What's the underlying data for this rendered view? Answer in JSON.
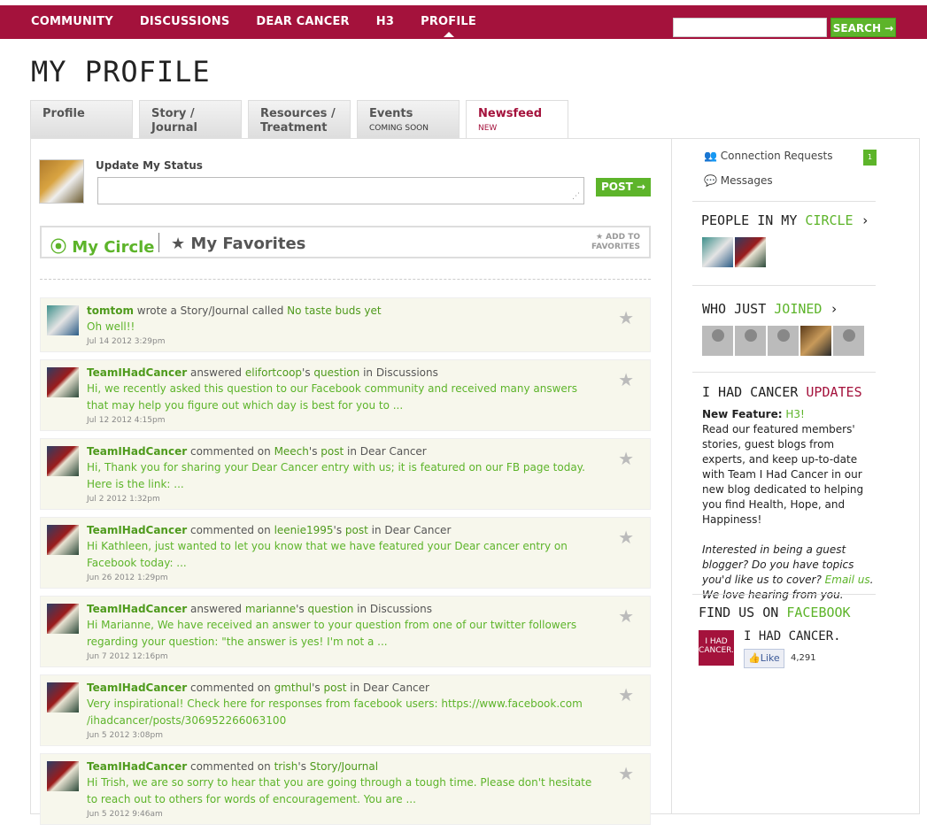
{
  "nav": {
    "items": [
      "COMMUNITY",
      "DISCUSSIONS",
      "DEAR CANCER",
      "H3",
      "PROFILE"
    ],
    "search_label": "SEARCH →"
  },
  "page": {
    "title": "MY PROFILE"
  },
  "tabs": [
    {
      "label": "Profile",
      "sub": ""
    },
    {
      "label": "Story /\nJournal",
      "label1": "Story /",
      "label2": "Journal"
    },
    {
      "label1": "Resources /",
      "label2": "Treatment"
    },
    {
      "label": "Events",
      "sub": "COMING SOON"
    },
    {
      "label": "Newsfeed",
      "sub": "NEW"
    }
  ],
  "status": {
    "label": "Update My Status",
    "post": "POST →"
  },
  "circle": {
    "my_circle": "My Circle",
    "my_favorites": "My Favorites",
    "add1": "★ ADD TO",
    "add2": "FAVORITES"
  },
  "feed": [
    {
      "user": "tomtom",
      "action": " wrote a Story/Journal called ",
      "target": "No taste buds yet",
      "tail": "",
      "body": "Oh well!!",
      "time": "Jul 14 2012 3:29pm"
    },
    {
      "user": "TeamIHadCancer",
      "action": " answered ",
      "target": "elifortcoop",
      "mid": "'s ",
      "target2": "question",
      "tail": " in Discussions",
      "body": "Hi, we recently asked this question to our Facebook community and received many answers that may help you figure out which day is best for you to ...",
      "time": "Jul 12 2012 4:15pm"
    },
    {
      "user": "TeamIHadCancer",
      "action": " commented on ",
      "target": "Meech",
      "mid": "'s ",
      "target2": "post",
      "tail": " in Dear Cancer",
      "body": "Hi, Thank you for sharing your Dear Cancer entry with us; it is featured on our FB page today. Here is the link: ...",
      "time": "Jul 2 2012 1:32pm"
    },
    {
      "user": "TeamIHadCancer",
      "action": " commented on ",
      "target": "leenie1995",
      "mid": "'s ",
      "target2": "post",
      "tail": " in Dear Cancer",
      "body": "Hi Kathleen, just wanted to let you know that we have featured your Dear cancer entry on Facebook today: ...",
      "time": "Jun 26 2012 1:29pm"
    },
    {
      "user": "TeamIHadCancer",
      "action": " answered ",
      "target": "marianne",
      "mid": "'s ",
      "target2": "question",
      "tail": " in Discussions",
      "body": "Hi Marianne, We have received an answer to your question from one of our twitter followers regarding your question: \"the answer is yes! I'm not a ...",
      "time": "Jun 7 2012 12:16pm"
    },
    {
      "user": "TeamIHadCancer",
      "action": " commented on ",
      "target": "gmthul",
      "mid": "'s ",
      "target2": "post",
      "tail": " in Dear Cancer",
      "body": "Very inspirational! Check here for responses from facebook users: https://www.facebook.com /ihadcancer/posts/306952266063100",
      "time": "Jun 5 2012 3:08pm"
    },
    {
      "user": "TeamIHadCancer",
      "action": " commented on ",
      "target": "trish",
      "mid": "'s ",
      "target2": "Story/Journal",
      "tail": "",
      "body": "Hi Trish, we are so sorry to hear that you are going through a tough time. Please don't hesitate to reach out to others for words of encouragement. You are ...",
      "time": "Jun 5 2012 9:46am"
    }
  ],
  "sidebar": {
    "conn": "Connection Requests",
    "conn_count": "1",
    "messages": "Messages",
    "circle_a": "PEOPLE IN MY ",
    "circle_b": "CIRCLE",
    "joined_a": "WHO JUST ",
    "joined_b": "JOINED",
    "upd_a": "I HAD CANCER ",
    "upd_b": "UPDATES",
    "new_feature": "New Feature:",
    "h3": "H3!",
    "upd_text": "Read our featured members' stories, guest blogs from experts, and keep up-to-date with Team I Had Cancer in our new blog dedicated to helping you find Health, Hope, and Happiness!",
    "guest_a": "Interested in being a guest blogger? Do you have topics you'd like us to cover? ",
    "email": "Email us",
    "guest_b": ". We love hearing from you.",
    "find_a": "FIND US ON ",
    "find_b": "FACEBOOK",
    "fb_logo": "I HAD CANCER.",
    "fb_name": "I HAD CANCER.",
    "like": "Like",
    "like_count": "4,291"
  }
}
